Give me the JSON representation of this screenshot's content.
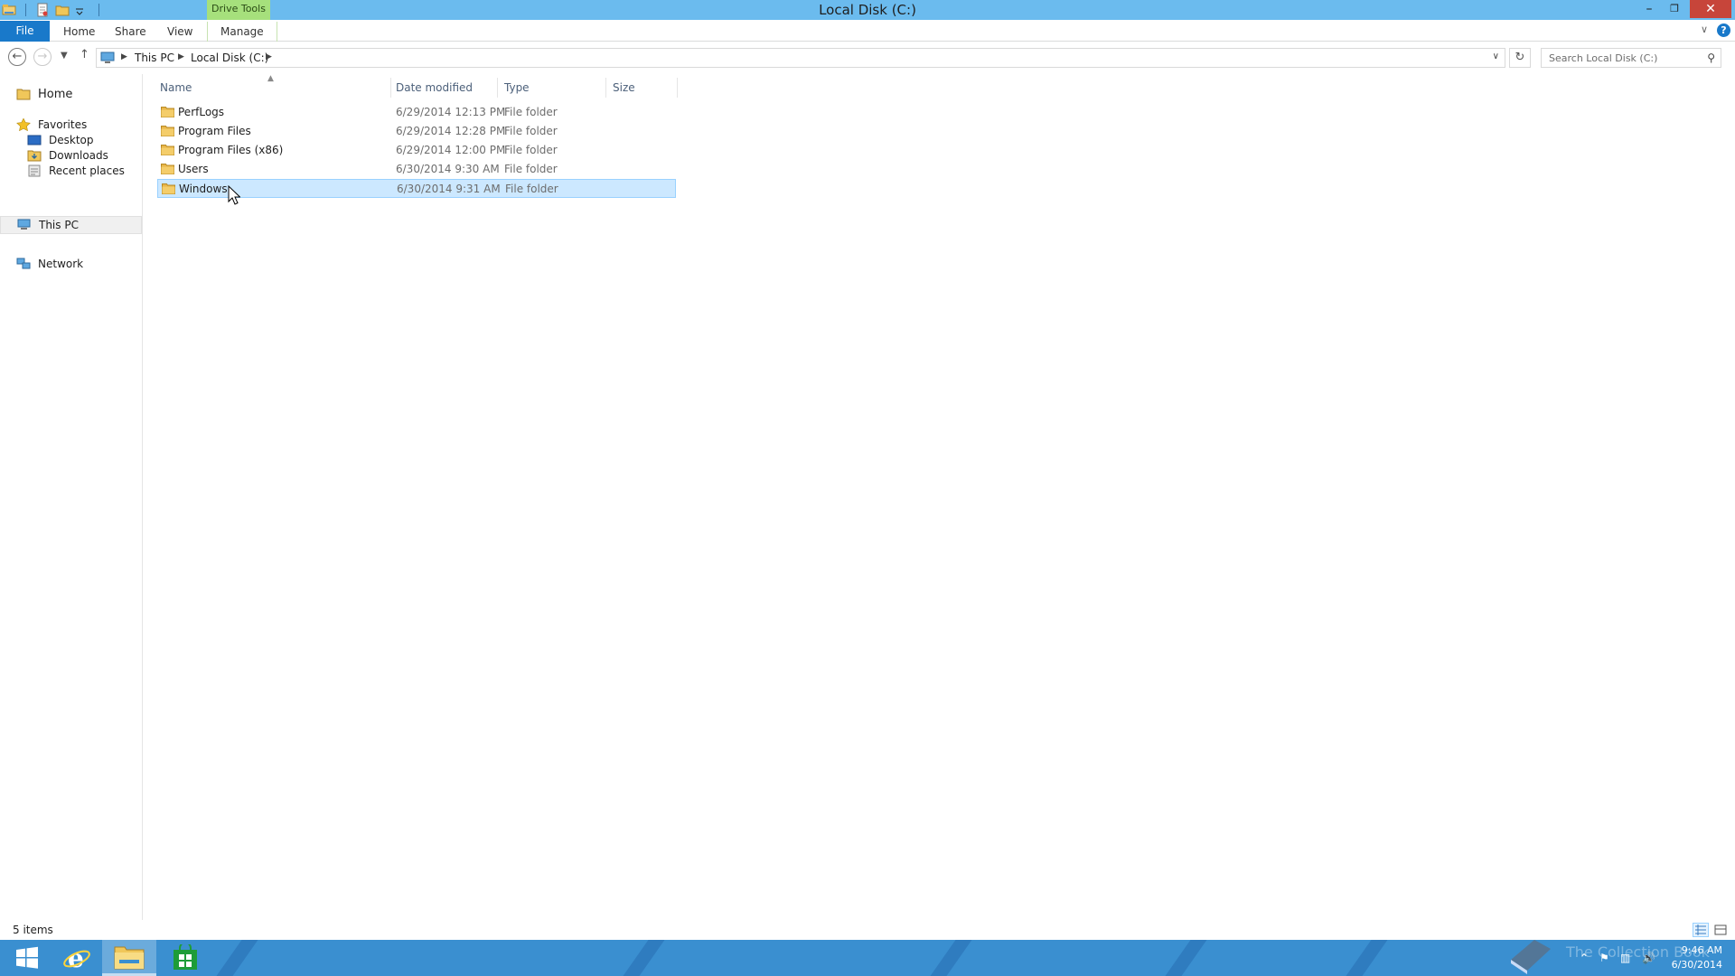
{
  "window": {
    "title": "Local Disk (C:)",
    "context_tab_group": "Drive Tools",
    "controls": {
      "minimize": "–",
      "restore": "❐",
      "close": "✕"
    }
  },
  "ribbon": {
    "file_tab": "File",
    "tabs": [
      "Home",
      "Share",
      "View",
      "Manage"
    ],
    "help": "?"
  },
  "address": {
    "breadcrumbs": [
      "This PC",
      "Local Disk (C:)"
    ],
    "search_placeholder": "Search Local Disk (C:)"
  },
  "navpane": {
    "home": "Home",
    "favorites": "Favorites",
    "favorites_items": [
      "Desktop",
      "Downloads",
      "Recent places"
    ],
    "this_pc": "This PC",
    "network": "Network"
  },
  "columns": {
    "name": "Name",
    "date": "Date modified",
    "type": "Type",
    "size": "Size"
  },
  "files": [
    {
      "name": "PerfLogs",
      "date": "6/29/2014 12:13 PM",
      "type": "File folder",
      "size": ""
    },
    {
      "name": "Program Files",
      "date": "6/29/2014 12:28 PM",
      "type": "File folder",
      "size": ""
    },
    {
      "name": "Program Files (x86)",
      "date": "6/29/2014 12:00 PM",
      "type": "File folder",
      "size": ""
    },
    {
      "name": "Users",
      "date": "6/30/2014 9:30 AM",
      "type": "File folder",
      "size": ""
    },
    {
      "name": "Windows",
      "date": "6/30/2014 9:31 AM",
      "type": "File folder",
      "size": ""
    }
  ],
  "status": {
    "item_count": "5 items"
  },
  "taskbar": {
    "clock_time": "9:46 AM",
    "clock_date": "6/30/2014",
    "watermark": "The Collection Book"
  },
  "colors": {
    "titlebar": "#6bbbee",
    "file_tab": "#1979ca",
    "context_tab": "#a6e07c",
    "selection": "#cce8ff",
    "taskbar": "#3a8fd0",
    "folder": "#e8b64a"
  },
  "icons": {
    "qat": [
      "explorer-icon",
      "properties-icon",
      "new-folder-icon",
      "customize-qat-icon"
    ],
    "folder": "folder-icon"
  }
}
